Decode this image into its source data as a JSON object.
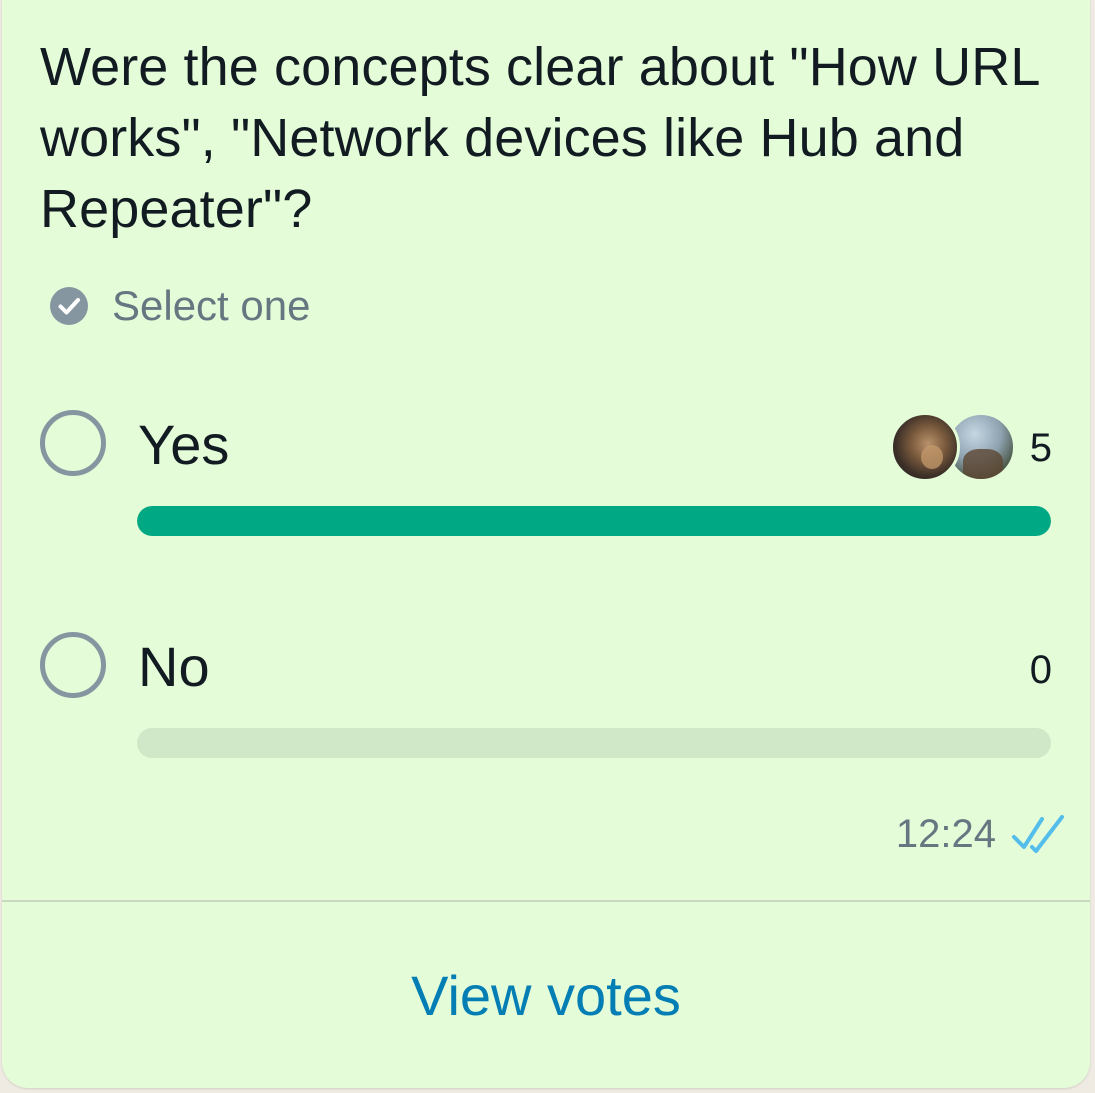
{
  "poll": {
    "question": "Were the concepts clear about \"How URL works\", \"Network devices like Hub and Repeater\"?",
    "select_hint": "Select one",
    "options": [
      {
        "label": "Yes",
        "votes": "5",
        "fraction": 1.0
      },
      {
        "label": "No",
        "votes": "0",
        "fraction": 0.0
      }
    ]
  },
  "meta": {
    "time": "12:24",
    "status_icon": "double-check-read-icon"
  },
  "actions": {
    "view_votes": "View votes"
  },
  "colors": {
    "bubble_bg": "#e4fcd8",
    "bar_fill": "#00a884",
    "bar_track": "#d1e8c8",
    "link": "#027eb5",
    "ticks_read": "#53bdeb"
  }
}
